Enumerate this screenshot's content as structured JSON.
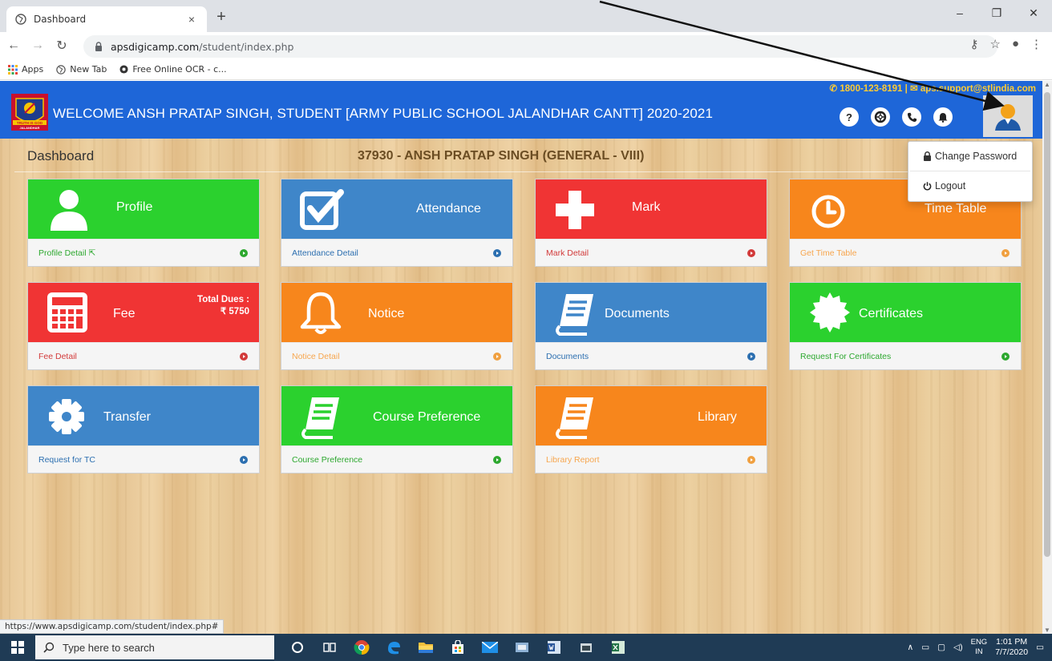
{
  "browser": {
    "tab_title": "Dashboard",
    "tab_close": "×",
    "new_tab": "+",
    "url_host": "apsdigicamp.com",
    "url_path": "/student/index.php",
    "bookmarks": [
      "Apps",
      "New Tab",
      "Free Online OCR - c..."
    ],
    "window_controls": [
      "–",
      "❐",
      "✕"
    ]
  },
  "header": {
    "welcome": "WELCOME ANSH PRATAP SINGH, STUDENT [ARMY PUBLIC SCHOOL JALANDHAR CANTT] 2020-2021",
    "phone": "1800-123-8191",
    "separator": "|",
    "email": "aps.support@stlindia.com",
    "help_glyph": "?",
    "logo_text": "TRUTH IS GOD",
    "logo_sub": "JALANDHAR"
  },
  "dropdown": {
    "change_password": "Change Password",
    "logout": "Logout"
  },
  "subheader": {
    "title": "Dashboard",
    "student": "37930 - ANSH PRATAP SINGH (GENERAL - VIII)"
  },
  "tiles": {
    "profile": {
      "label": "Profile",
      "link": "Profile Detail"
    },
    "attendance": {
      "label": "Attendance",
      "link": "Attendance Detail"
    },
    "mark": {
      "label": "Mark",
      "link": "Mark Detail"
    },
    "timetable": {
      "label": "Time Table",
      "link": "Get Time Table"
    },
    "fee": {
      "label": "Fee",
      "link": "Fee Detail",
      "dues_label": "Total Dues :",
      "dues_value": "₹ 5750"
    },
    "notice": {
      "label": "Notice",
      "link": "Notice Detail"
    },
    "documents": {
      "label": "Documents",
      "link": "Documents"
    },
    "certificates": {
      "label": "Certificates",
      "link": "Request For Certificates"
    },
    "transfer": {
      "label": "Transfer",
      "link": "Request for TC"
    },
    "course": {
      "label": "Course Preference",
      "link": "Course Preference"
    },
    "library": {
      "label": "Library",
      "link": "Library Report"
    }
  },
  "status_url": "https://www.apsdigicamp.com/student/index.php#",
  "taskbar": {
    "search_placeholder": "Type here to search",
    "lang_top": "ENG",
    "lang_bottom": "IN",
    "time": "1:01 PM",
    "date": "7/7/2020"
  },
  "colors": {
    "header_blue": "#1e66d8",
    "tile_green": "#2bd12e",
    "tile_blue": "#3f86c9",
    "tile_red": "#f03434",
    "tile_orange": "#f7861c",
    "contact_yellow": "#ffcc33"
  }
}
